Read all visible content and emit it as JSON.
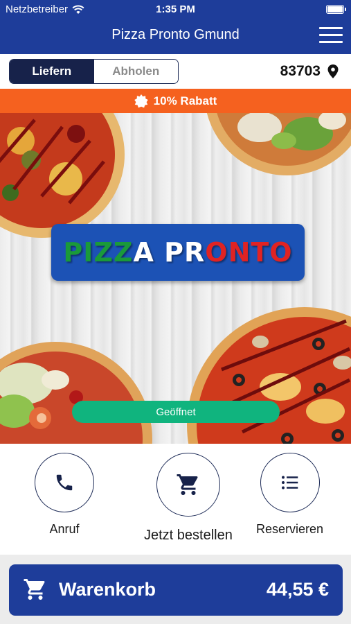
{
  "status_bar": {
    "carrier": "Netzbetreiber",
    "time": "1:35 PM"
  },
  "header": {
    "title": "Pizza Pronto Gmund"
  },
  "mode_toggle": {
    "options": [
      "Liefern",
      "Abholen"
    ],
    "selected": "Liefern"
  },
  "location": {
    "zip": "83703"
  },
  "promo": {
    "text": "10% Rabatt"
  },
  "hero": {
    "logo_parts": [
      "PIZZ",
      "A ",
      "PR",
      "ONTO"
    ],
    "status": "Geöffnet"
  },
  "actions": [
    {
      "label": "Anruf",
      "icon": "phone-icon"
    },
    {
      "label": "Jetzt bestellen",
      "icon": "cart-icon"
    },
    {
      "label": "Reservieren",
      "icon": "list-icon"
    }
  ],
  "cart": {
    "label": "Warenkorb",
    "total": "44,55 €"
  },
  "colors": {
    "primary": "#1e3d9a",
    "dark_navy": "#17224a",
    "promo": "#f5611f",
    "open": "#10b47e"
  }
}
